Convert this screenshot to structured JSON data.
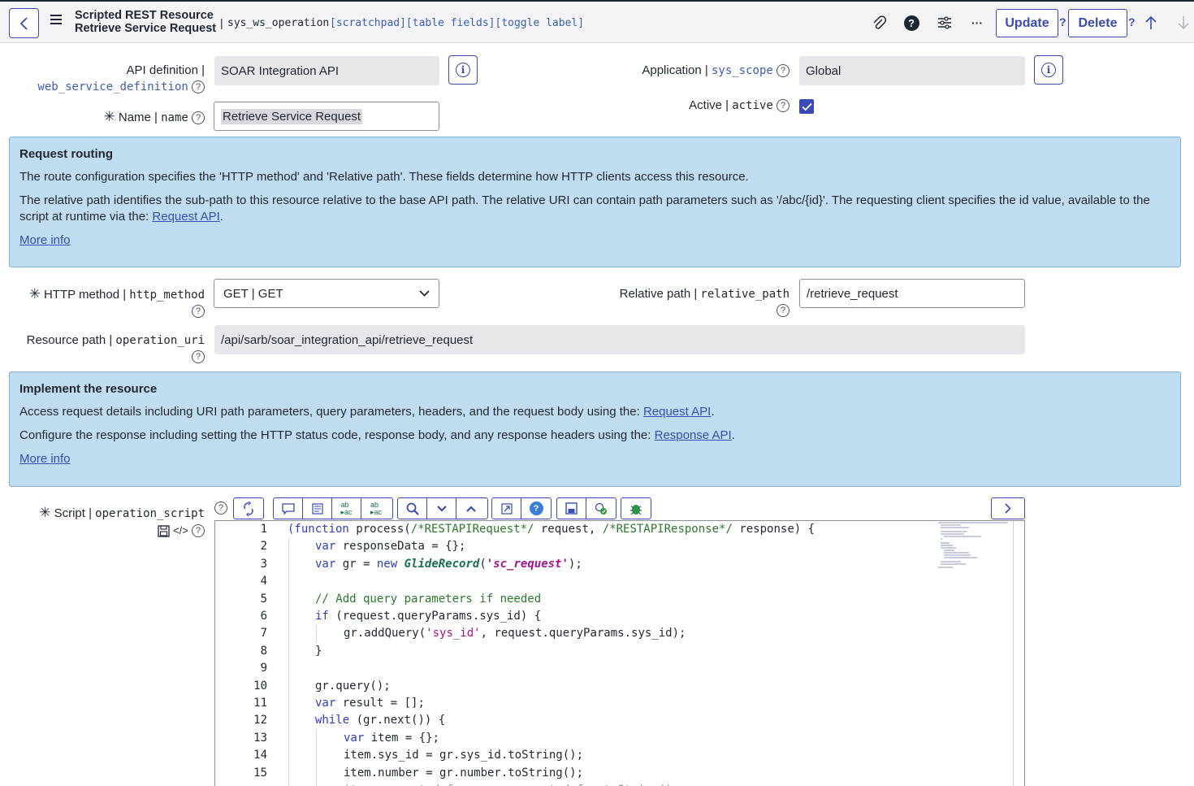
{
  "header": {
    "title_line1": "Scripted REST Resource",
    "title_line2": "Retrieve Service Request",
    "separator": "|",
    "table_name": "sys_ws_operation",
    "links": "[scratchpad][table fields][toggle label]",
    "update_label": "Update",
    "delete_label": "Delete",
    "qmark": "?",
    "help_glyph": "?",
    "more_glyph": "···"
  },
  "form": {
    "api_definition": {
      "label": "API definition |",
      "field": "web_service_definition",
      "value": "SOAR Integration API"
    },
    "application": {
      "label": "Application |",
      "field": "sys_scope",
      "value": "Global"
    },
    "name": {
      "label": "Name |",
      "field": "name",
      "value": "Retrieve Service Request"
    },
    "active": {
      "label": "Active |",
      "field": "active",
      "checked": true
    },
    "http_method": {
      "label": "HTTP method |",
      "field": "http_method",
      "value": "GET | GET"
    },
    "relative_path": {
      "label": "Relative path |",
      "field": "relative_path",
      "value": "/retrieve_request"
    },
    "resource_path": {
      "label": "Resource path |",
      "field": "operation_uri",
      "value": "/api/sarb/soar_integration_api/retrieve_request"
    },
    "script": {
      "label": "Script |",
      "field": "operation_script"
    }
  },
  "request_routing": {
    "title": "Request routing",
    "p1": "The route configuration specifies the 'HTTP method' and 'Relative path'. These fields determine how HTTP clients access this resource.",
    "p2_text": "The relative path identifies the sub-path to this resource relative to the base API path. The relative URI can contain path parameters such as '/abc/{id}'. The requesting client specifies the id value, available to the script at runtime via the: ",
    "p2_link": "Request API",
    "more_info": "More info"
  },
  "implement": {
    "title": "Implement the resource",
    "p1_text": "Access request details including URI path parameters, query parameters, headers, and the request body using the: ",
    "p1_link": "Request API",
    "p2_text": "Configure the response including setting the HTTP status code, response body, and any response headers using the: ",
    "p2_link": "Response API",
    "more_info": "More info"
  },
  "code_lines": [
    "1",
    "2",
    "3",
    "4",
    "5",
    "6",
    "7",
    "8",
    "9",
    "10",
    "11",
    "12",
    "13",
    "14",
    "15"
  ],
  "colors": {
    "accent": "#3a4bb5",
    "info_bg": "#bfdcf0",
    "readonly_bg": "#e6e7ea"
  },
  "icons": [
    "back-icon",
    "menu-icon",
    "paperclip-icon",
    "help-icon",
    "settings-sliders-icon",
    "more-icon",
    "arrow-up-icon",
    "arrow-down-icon",
    "info-icon",
    "checkbox-icon",
    "chevron-down-icon",
    "save-icon",
    "code-icon"
  ]
}
